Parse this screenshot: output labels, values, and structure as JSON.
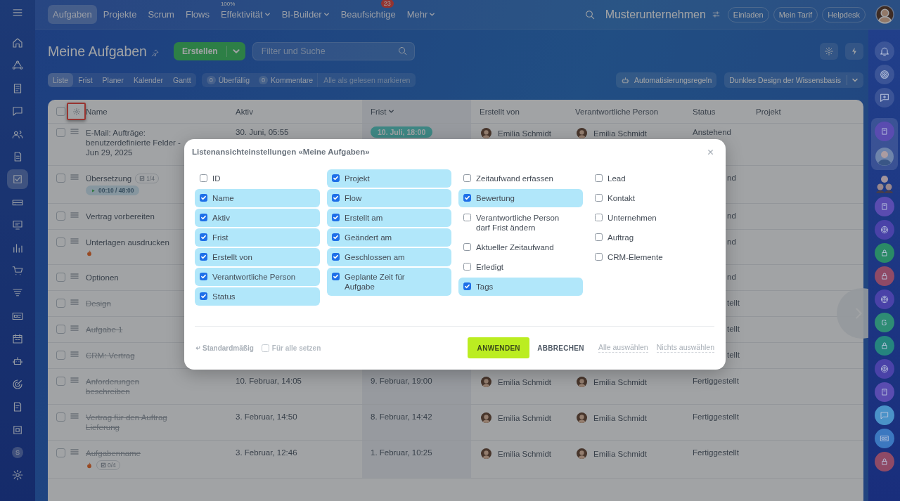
{
  "left_sidebar": {
    "items": [
      {
        "kind": "home",
        "selected": false
      },
      {
        "kind": "flow",
        "selected": false
      },
      {
        "kind": "doc",
        "selected": false
      },
      {
        "kind": "chat",
        "selected": false
      },
      {
        "kind": "people",
        "selected": false
      },
      {
        "kind": "page",
        "selected": false
      },
      {
        "kind": "check",
        "selected": true
      },
      {
        "kind": "drive",
        "selected": false
      },
      {
        "kind": "board",
        "selected": false
      },
      {
        "kind": "chart",
        "selected": false
      },
      {
        "kind": "cart",
        "selected": false
      },
      {
        "kind": "funnel",
        "selected": false
      },
      {
        "kind": "card",
        "selected": false
      },
      {
        "kind": "calendar",
        "selected": false
      },
      {
        "kind": "robot",
        "selected": false
      },
      {
        "kind": "target",
        "selected": false
      },
      {
        "kind": "edit",
        "selected": false
      },
      {
        "kind": "box",
        "selected": false
      },
      {
        "kind": "letter",
        "text": "S",
        "selected": false
      },
      {
        "kind": "gear",
        "selected": false
      }
    ]
  },
  "top_bar": {
    "tabs": [
      {
        "label": "Aufgaben",
        "selected": true,
        "dropdown": false
      },
      {
        "label": "Projekte",
        "selected": false,
        "dropdown": false
      },
      {
        "label": "Scrum",
        "selected": false,
        "dropdown": false
      },
      {
        "label": "Flows",
        "selected": false,
        "dropdown": false
      },
      {
        "label": "Effektivität",
        "selected": false,
        "dropdown": true,
        "note": "100%"
      },
      {
        "label": "BI-Builder",
        "selected": false,
        "dropdown": true
      },
      {
        "label": "Beaufsichtige",
        "selected": false,
        "dropdown": false,
        "counter": "23"
      },
      {
        "label": "Mehr",
        "selected": false,
        "dropdown": true
      }
    ],
    "company": "Musterunternehmen",
    "buttons": [
      "Einladen",
      "Mein Tarif",
      "Helpdesk"
    ]
  },
  "header": {
    "title": "Meine Aufgaben",
    "create_button": "Erstellen",
    "search": {
      "placeholder": "Filter und Suche"
    }
  },
  "view_tabs": [
    {
      "label": "Liste",
      "selected": true
    },
    {
      "label": "Frist",
      "selected": false
    },
    {
      "label": "Planer",
      "selected": false
    },
    {
      "label": "Kalender",
      "selected": false
    },
    {
      "label": "Gantt",
      "selected": false
    }
  ],
  "counters": [
    {
      "count": "0",
      "label": "Überfällig"
    },
    {
      "count": "0",
      "label": "Kommentare"
    }
  ],
  "mark_read": "Alle als gelesen markieren",
  "automation_button": "Automatisierungsregeln",
  "design_button": "Dunkles Design der Wissensbasis",
  "table": {
    "settings_highlighted": true,
    "all_selected": false,
    "columns": [
      {
        "label": "Name",
        "sorted": false
      },
      {
        "label": "Aktiv",
        "sorted": false
      },
      {
        "label": "Frist",
        "sorted": true
      },
      {
        "label": "Erstellt von",
        "sorted": false
      },
      {
        "label": "Verantwortliche Person",
        "sorted": false
      },
      {
        "label": "Status",
        "sorted": false
      },
      {
        "label": "Projekt",
        "sorted": false
      }
    ],
    "rows": [
      {
        "name": "E-Mail: Aufträge: benutzerdefinierte Felder - Jun 29, 2025",
        "selected": false,
        "completed": false,
        "important": false,
        "aktiv": "30. Juni, 05:55",
        "frist": "10. Juli, 18:00",
        "frist_pill": true,
        "creator": "Emilia Schmidt",
        "responsible": "Emilia Schmidt",
        "status": "Anstehend"
      },
      {
        "name": "Übersetzung",
        "selected": false,
        "completed": false,
        "important": false,
        "checklist": "1/4",
        "timer": "00:10 / 48:00",
        "status_visible_part": "nd"
      },
      {
        "name": "Vertrag vorbereiten",
        "selected": false,
        "completed": false,
        "important": false,
        "status_visible_part": "nd"
      },
      {
        "name": "Unterlagen ausdrucken",
        "selected": false,
        "completed": false,
        "important": true,
        "status_visible_part": "nd"
      },
      {
        "name": "Optionen",
        "selected": false,
        "completed": false,
        "important": false,
        "status_visible_part": "nd"
      },
      {
        "name": "Design",
        "selected": false,
        "completed": true,
        "important": false,
        "status_visible_part": "tellt"
      },
      {
        "name": "Aufgabe 1",
        "selected": false,
        "completed": true,
        "important": false,
        "status_visible_part": "tellt"
      },
      {
        "name": "CRM: Vertrag",
        "selected": false,
        "completed": true,
        "important": false,
        "status_visible_part": "tellt"
      },
      {
        "name": "Anforderungen beschreiben",
        "selected": false,
        "completed": true,
        "important": false,
        "aktiv": "10. Februar, 14:05",
        "frist": "9. Februar, 19:00",
        "frist_pill": false,
        "creator": "Emilia Schmidt",
        "responsible": "Emilia Schmidt",
        "status": "Fertiggestellt"
      },
      {
        "name": "Vertrag für den Auftrag Lieferung",
        "selected": false,
        "completed": true,
        "important": false,
        "aktiv": "3. Februar, 14:50",
        "frist": "8. Februar, 14:42",
        "frist_pill": false,
        "creator": "Emilia Schmidt",
        "responsible": "Emilia Schmidt",
        "status": "Fertiggestellt"
      },
      {
        "name": "Aufgabenname",
        "selected": false,
        "completed": true,
        "important": true,
        "checklist": "0/4",
        "aktiv": "3. Februar, 12:46",
        "frist": "1. Februar, 10:25",
        "frist_pill": false,
        "creator": "Emilia Schmidt",
        "responsible": "Emilia Schmidt",
        "status": "Fertiggestellt"
      }
    ]
  },
  "right_sidebar": {
    "items": [
      {
        "kind": "bell"
      },
      {
        "kind": "ring"
      },
      {
        "kind": "chat"
      }
    ],
    "panel": [
      {
        "kind": "book",
        "color": "#5a4cb0"
      },
      {
        "kind": "avatar"
      }
    ],
    "apps": [
      {
        "kind": "group"
      },
      {
        "kind": "book",
        "color": "#5a4cb0"
      },
      {
        "kind": "ring",
        "color": "#4a42a8"
      },
      {
        "kind": "lock",
        "color": "#2a8a66"
      },
      {
        "kind": "lock",
        "color": "#8f4a66"
      },
      {
        "kind": "ring",
        "color": "#4a42a8"
      },
      {
        "kind": "letter",
        "text": "G",
        "color": "#2e8c74"
      },
      {
        "kind": "lock",
        "color": "#25857e"
      },
      {
        "kind": "ring",
        "color": "#4a42a8"
      },
      {
        "kind": "book",
        "color": "#5a4cb0"
      },
      {
        "kind": "chat",
        "color": "#4a92c8"
      },
      {
        "kind": "card",
        "color": "#3c78c0"
      },
      {
        "kind": "lock",
        "color": "#8f4a66"
      }
    ]
  },
  "dialog": {
    "title": "Listenansichteinstellungen «Meine Aufgaben»",
    "columns": [
      {
        "items": [
          {
            "label": "ID",
            "checked": false
          },
          {
            "label": "Name",
            "checked": true
          },
          {
            "label": "Aktiv",
            "checked": true
          },
          {
            "label": "Frist",
            "checked": true
          },
          {
            "label": "Erstellt von",
            "checked": true
          },
          {
            "label": "Verantwortliche Person",
            "checked": true
          },
          {
            "label": "Status",
            "checked": true
          }
        ]
      },
      {
        "items": [
          {
            "label": "Projekt",
            "checked": true
          },
          {
            "label": "Flow",
            "checked": true
          },
          {
            "label": "Erstellt am",
            "checked": true
          },
          {
            "label": "Geändert am",
            "checked": true
          },
          {
            "label": "Geschlossen am",
            "checked": true
          },
          {
            "label": "Geplante Zeit für Aufgabe",
            "checked": true
          }
        ]
      },
      {
        "items": [
          {
            "label": "Zeitaufwand erfassen",
            "checked": false
          },
          {
            "label": "Bewertung",
            "checked": true
          },
          {
            "label": "Verantwortliche Person darf Frist ändern",
            "checked": false
          },
          {
            "label": "Aktueller Zeitaufwand",
            "checked": false
          },
          {
            "label": "Erledigt",
            "checked": false
          },
          {
            "label": "Tags",
            "checked": true
          }
        ]
      },
      {
        "items": [
          {
            "label": "Lead",
            "checked": false
          },
          {
            "label": "Kontakt",
            "checked": false
          },
          {
            "label": "Unternehmen",
            "checked": false
          },
          {
            "label": "Auftrag",
            "checked": false
          },
          {
            "label": "CRM-Elemente",
            "checked": false
          }
        ]
      }
    ],
    "reset": "Standardmäßig",
    "for_all": {
      "label": "Für alle setzen",
      "checked": false
    },
    "apply": "ANWENDEN",
    "cancel": "ABBRECHEN",
    "select_all": "Alle auswählen",
    "select_none": "Nichts auswählen"
  }
}
